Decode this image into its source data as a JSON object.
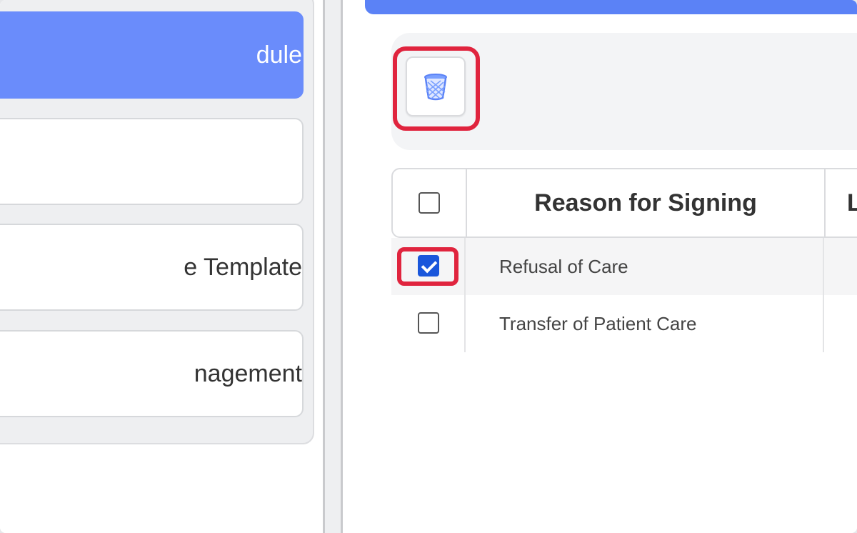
{
  "sidebar": {
    "items": [
      {
        "label": "dule",
        "active": true
      },
      {
        "label": "",
        "active": false
      },
      {
        "label": "e Template",
        "active": false
      },
      {
        "label": "nagement",
        "active": false
      }
    ]
  },
  "toolbar": {
    "delete_icon": "trash-icon"
  },
  "table": {
    "headers": [
      "Reason for Signing",
      "L"
    ],
    "rows": [
      {
        "label": "Refusal of Care",
        "checked": true
      },
      {
        "label": "Transfer of Patient Care",
        "checked": false
      }
    ]
  },
  "colors": {
    "accent": "#5b82f6",
    "active_menu": "#6a8cfb",
    "highlight": "#e0243e",
    "checkbox_checked": "#1a56db"
  }
}
